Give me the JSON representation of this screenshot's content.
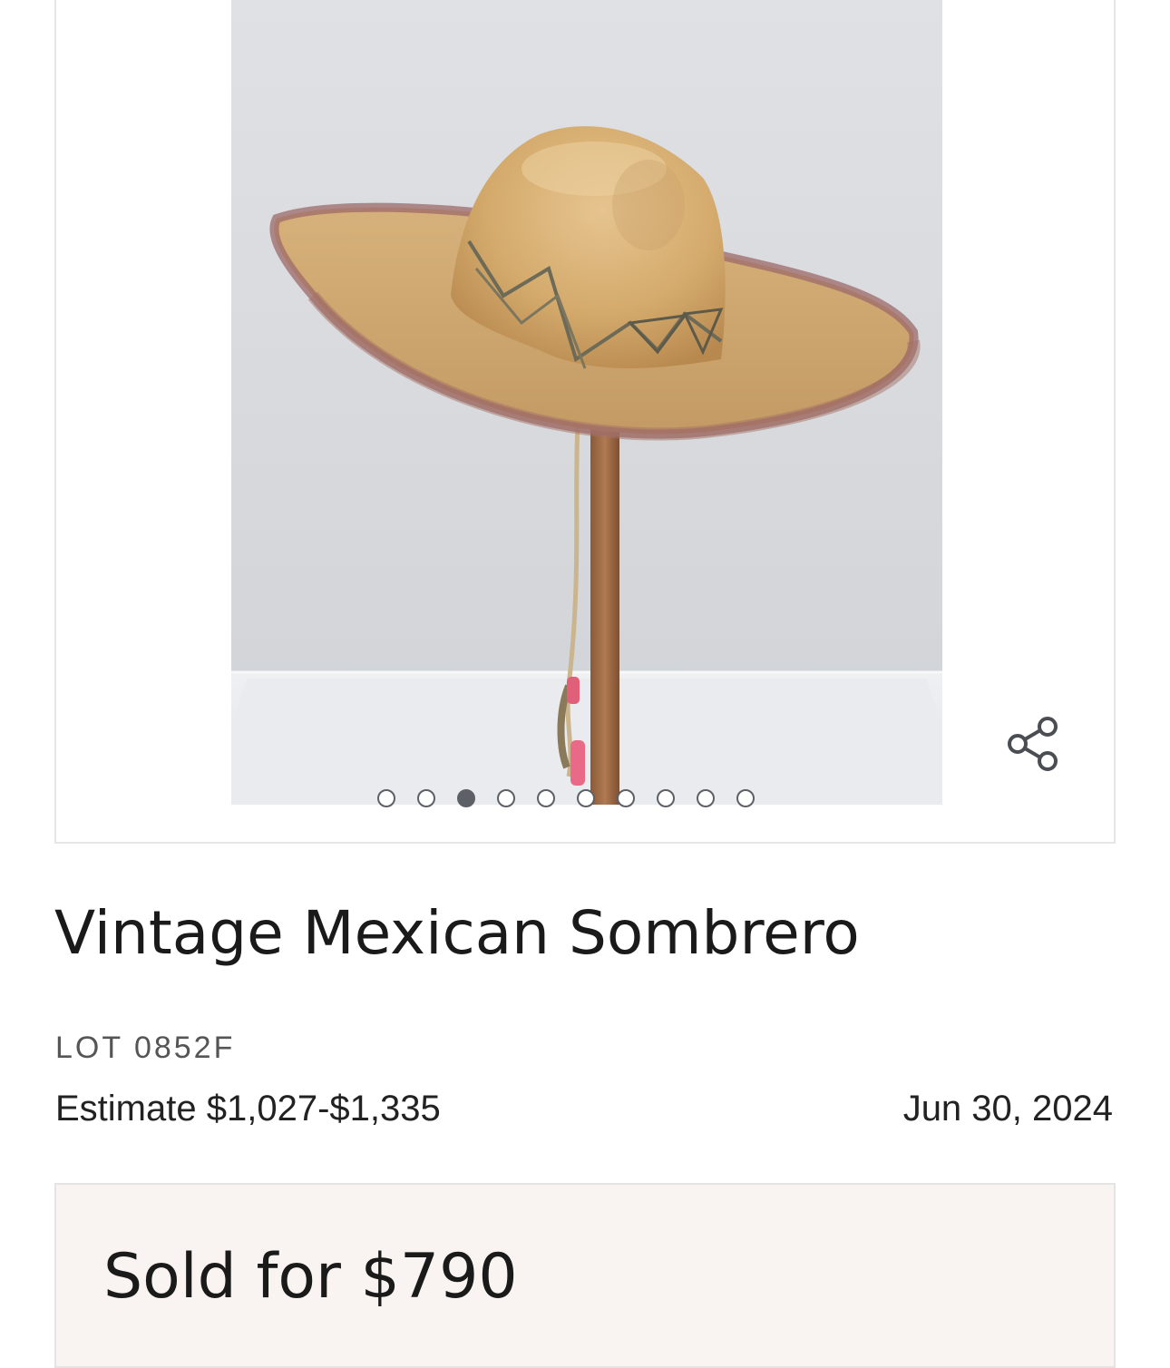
{
  "gallery": {
    "image_subject": "sombrero-photo",
    "share_icon": "share-icon",
    "dot_count": 10,
    "active_dot_index": 2
  },
  "lot": {
    "title": "Vintage Mexican Sombrero",
    "lot_number": "LOT 0852F",
    "estimate": "Estimate $1,027-$1,335",
    "date": "Jun 30, 2024"
  },
  "result": {
    "sold_label": "Sold for $790"
  },
  "colors": {
    "dot": "#5d6066",
    "sold_panel_bg": "#f9f4f1",
    "text": "#1a1a1a"
  }
}
